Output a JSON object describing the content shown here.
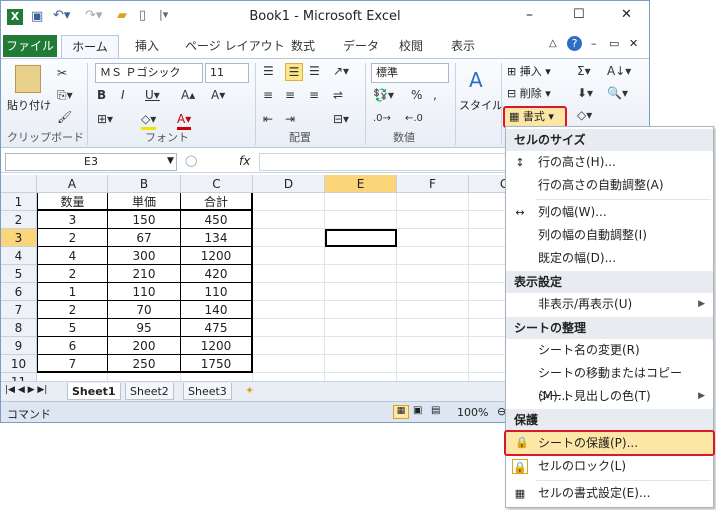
{
  "window": {
    "title": "Book1 - Microsoft Excel",
    "min": "–",
    "max": "☐",
    "close": "✕"
  },
  "tabs": {
    "file": "ファイル",
    "home": "ホーム",
    "insert": "挿入",
    "layout": "ページ レイアウト",
    "formula": "数式",
    "data": "データ",
    "review": "校閲",
    "view": "表示"
  },
  "ribbon": {
    "paste": "貼り付け",
    "clipboard": "クリップボード",
    "font_name": "ＭＳ Ｐゴシック",
    "font_size": "11",
    "font": "フォント",
    "align": "配置",
    "numfmt": "標準",
    "number": "数値",
    "pct": "%",
    "style": "スタイル",
    "insert": "挿入",
    "delete": "削除",
    "format": "書式"
  },
  "formula": {
    "namebox": "E3",
    "fx": "fx"
  },
  "columns": [
    "A",
    "B",
    "C",
    "D",
    "E",
    "F",
    "G"
  ],
  "rows": [
    [
      "1",
      "数量",
      "単価",
      "合計"
    ],
    [
      "2",
      "3",
      "150",
      "450"
    ],
    [
      "3",
      "2",
      "67",
      "134"
    ],
    [
      "4",
      "4",
      "300",
      "1200"
    ],
    [
      "5",
      "2",
      "210",
      "420"
    ],
    [
      "6",
      "1",
      "110",
      "110"
    ],
    [
      "7",
      "2",
      "70",
      "140"
    ],
    [
      "8",
      "5",
      "95",
      "475"
    ],
    [
      "9",
      "6",
      "200",
      "1200"
    ],
    [
      "10",
      "7",
      "250",
      "1750"
    ],
    [
      "11",
      "",
      "",
      ""
    ]
  ],
  "sheets": [
    "Sheet1",
    "Sheet2",
    "Sheet3"
  ],
  "status": {
    "mode": "コマンド",
    "zoom": "100%"
  },
  "menu": {
    "h1": "セルのサイズ",
    "row_height": "行の高さ(H)...",
    "row_auto": "行の高さの自動調整(A)",
    "col_width": "列の幅(W)...",
    "col_auto": "列の幅の自動調整(I)",
    "default_width": "既定の幅(D)...",
    "h2": "表示設定",
    "hide": "非表示/再表示(U)",
    "h3": "シートの整理",
    "rename": "シート名の変更(R)",
    "move": "シートの移動またはコピー(M)...",
    "tabcolor": "シート見出しの色(T)",
    "h4": "保護",
    "protect": "シートの保護(P)...",
    "lock": "セルのロック(L)",
    "cellformat": "セルの書式設定(E)..."
  },
  "colors": {
    "file_tab": "#1f7b36",
    "highlight": "#d9182b"
  }
}
